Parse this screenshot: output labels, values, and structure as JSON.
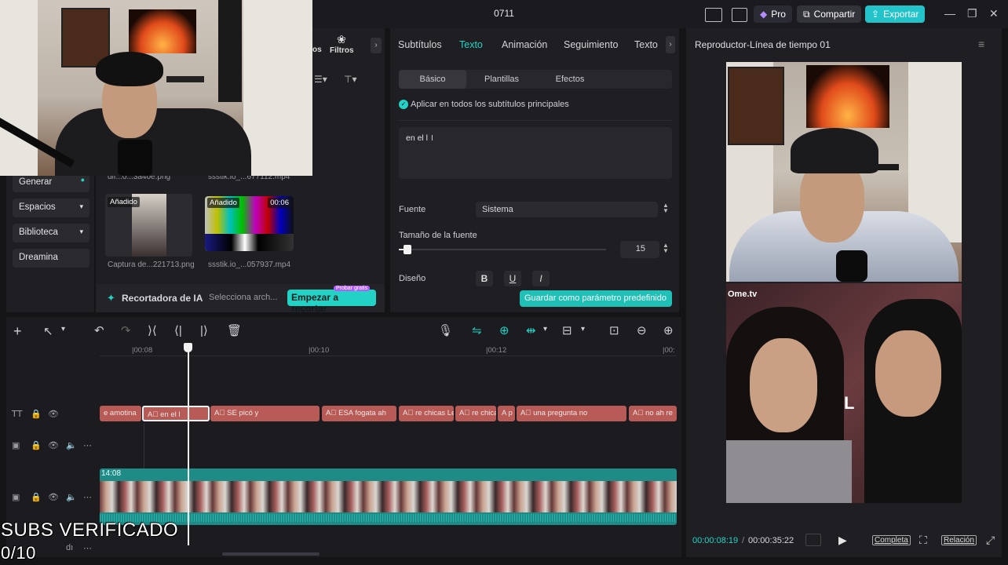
{
  "window": {
    "title": "0711",
    "pro_label": "Pro",
    "share_label": "Compartir",
    "export_label": "Exportar"
  },
  "media_panel": {
    "filters_label": "Filtros",
    "partial_tab_label": "os",
    "nav": [
      "Generar",
      "Espacios",
      "Biblioteca",
      "Dreamina"
    ],
    "thumb_captions_top": [
      "dlf...0...3a40e.png",
      "ssstik.io_...677112.mp4"
    ],
    "items": [
      {
        "badge": "Añadido",
        "caption": "Captura de...221713.png",
        "duration": ""
      },
      {
        "badge": "Añadido",
        "caption": "ssstik.io_...057937.mp4",
        "duration": "00:06"
      }
    ],
    "ai_cropper_label": "Recortadora de IA",
    "select_file_label": "Selecciona arch...",
    "start_crop_label": "Empezar a recortar",
    "try_free_label": "Probar gratis"
  },
  "text_panel": {
    "tabs": [
      "Subtítulos",
      "Texto",
      "Animación",
      "Seguimiento",
      "Texto"
    ],
    "active_tab": "Texto",
    "subtabs": [
      "Básico",
      "Plantillas",
      "Efectos"
    ],
    "apply_all_label": "Aplicar en todos los subtítulos principales",
    "text_value": "en el l",
    "font_label": "Fuente",
    "font_value": "Sistema",
    "font_size_label": "Tamaño de la fuente",
    "font_size_value": "15",
    "design_label": "Diseño",
    "save_preset_label": "Guardar como parámetro predefinido"
  },
  "player": {
    "title": "Reproductor-Línea de tiempo 01",
    "watermark": "Ome.tv",
    "current_time": "00:00:08:19",
    "total_time": "00:00:35:22",
    "complete_label": "Completa",
    "ratio_label": "Relación"
  },
  "timeline": {
    "ruler": [
      "00:08",
      "00:10",
      "00:12",
      "00:"
    ],
    "subtitle_clips": [
      "e amotina",
      "en el l",
      "SE picó y",
      "ESA fogata ah",
      "re chicas Le",
      "re chica",
      "p",
      "una pregunta no",
      "no ah re"
    ],
    "video_clip_duration": "14:08"
  },
  "overlay": {
    "line1": "SUBS VERIFICADO",
    "line2": "0/10"
  },
  "colors": {
    "accent": "#22d3c5",
    "subtitle_clip": "#b85a55",
    "video_clip": "#1e8b86"
  }
}
